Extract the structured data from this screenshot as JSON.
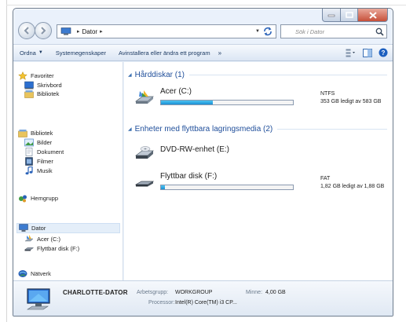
{
  "window": {
    "address": {
      "segments": [
        "Dator"
      ],
      "search_placeholder": "Sök i Dator"
    }
  },
  "toolbar": {
    "items": [
      "Ordna",
      "Systemegenskaper",
      "Avinstallera eller ändra ett program"
    ],
    "more": "»"
  },
  "sidebar": {
    "favorites": {
      "title": "Favoriter",
      "items": [
        "Skrivbord",
        "Bibliotek"
      ]
    },
    "libraries": {
      "title": "Bibliotek",
      "items": [
        "Bilder",
        "Dokument",
        "Filmer",
        "Musik"
      ]
    },
    "homegroup": "Hemgrupp",
    "computer": {
      "title": "Dator",
      "items": [
        "Acer (C:)",
        "Flyttbar disk (F:)"
      ]
    },
    "network": "Nätverk"
  },
  "groups": [
    {
      "title": "Hårddiskar (1)",
      "drives": [
        {
          "name": "Acer (C:)",
          "fs": "NTFS",
          "space": "353 GB ledigt av 583 GB",
          "used_fraction": 0.39
        }
      ]
    },
    {
      "title": "Enheter med flyttbara lagringsmedia (2)",
      "drives": [
        {
          "name": "DVD-RW-enhet (E:)"
        },
        {
          "name": "Flyttbar disk (F:)",
          "fs": "FAT",
          "space": "1,82 GB ledigt av 1,88 GB",
          "used_fraction": 0.03
        }
      ]
    }
  ],
  "details": {
    "computer_name": "CHARLOTTE-DATOR",
    "workgroup_label": "Arbetsgrupp:",
    "workgroup": "WORKGROUP",
    "memory_label": "Minne:",
    "memory": "4,00 GB",
    "processor_label": "Processor:",
    "processor": "Intel(R) Core(TM) i3 CP..."
  },
  "colors": {
    "accent": "#1f4e9a",
    "drive_bar": "#1a8fd4",
    "frame": "#eaf1fb"
  }
}
